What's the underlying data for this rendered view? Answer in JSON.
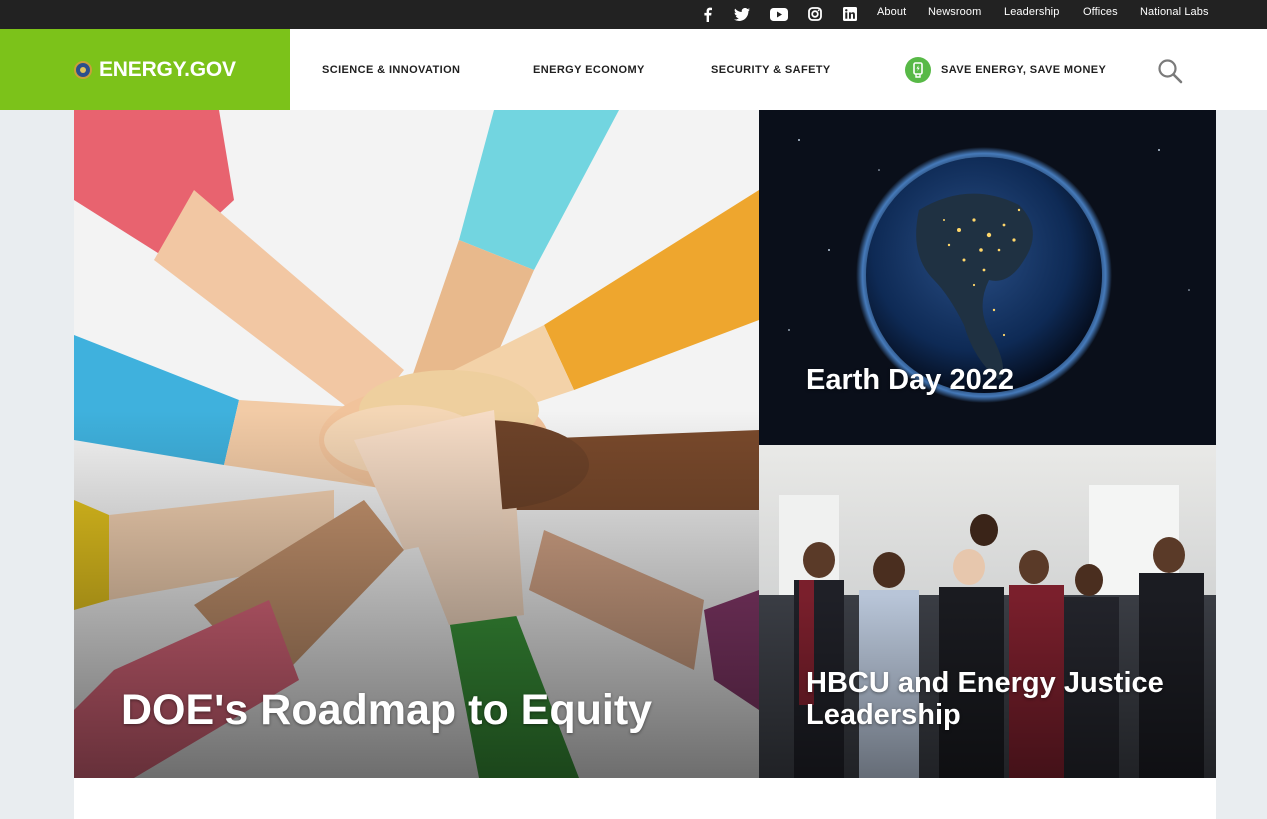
{
  "social": {
    "facebook_icon": "facebook-icon",
    "twitter_icon": "twitter-icon",
    "youtube_icon": "youtube-icon",
    "instagram_icon": "instagram-icon",
    "linkedin_icon": "linkedin-icon"
  },
  "utility_nav": {
    "about": "About",
    "newsroom": "Newsroom",
    "leadership": "Leadership",
    "offices": "Offices",
    "national_labs": "National Labs"
  },
  "header": {
    "logo_text": "ENERGY.GOV",
    "nav": {
      "science": "SCIENCE & INNOVATION",
      "economy": "ENERGY ECONOMY",
      "security": "SECURITY & SAFETY",
      "save_energy": "SAVE ENERGY, SAVE MONEY"
    },
    "search_icon": "search-icon"
  },
  "hero": {
    "main_title": "DOE's Roadmap to Equity",
    "top_title": "Earth Day 2022",
    "bottom_title": "HBCU and Energy Justice Leadership"
  },
  "colors": {
    "brand_green": "#7cc21a",
    "topbar": "#222222",
    "badge_green": "#58b947",
    "page_bg": "#e9edf0"
  }
}
